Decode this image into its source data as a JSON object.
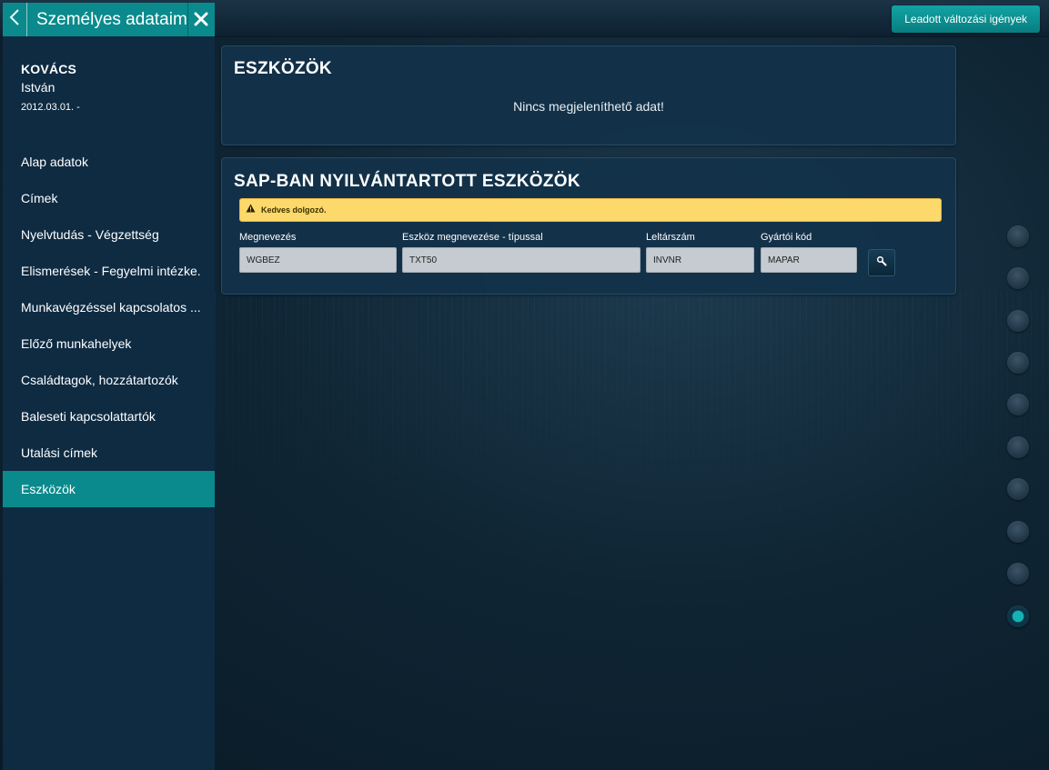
{
  "header": {
    "title": "Személyes adataim",
    "back_icon": "chevron-left-icon",
    "close_icon": "close-icon",
    "requests_button": "Leadott változási igények"
  },
  "user": {
    "surname": "KOVÁCS",
    "firstname": "István",
    "date": "2012.03.01. -"
  },
  "sidebar": {
    "items": [
      {
        "label": "Alap adatok",
        "active": false
      },
      {
        "label": "Címek",
        "active": false
      },
      {
        "label": "Nyelvtudás - Végzettség",
        "active": false
      },
      {
        "label": "Elismerések - Fegyelmi intézke.",
        "active": false
      },
      {
        "label": "Munkavégzéssel kapcsolatos ...",
        "active": false
      },
      {
        "label": "Előző munkahelyek",
        "active": false
      },
      {
        "label": "Családtagok, hozzátartozók",
        "active": false
      },
      {
        "label": "Baleseti kapcsolattartók",
        "active": false
      },
      {
        "label": "Utalási címek",
        "active": false
      },
      {
        "label": "Eszközök",
        "active": true
      }
    ]
  },
  "panel_assets": {
    "title": "ESZKÖZÖK",
    "empty_message": "Nincs megjeleníthető adat!"
  },
  "panel_sap": {
    "title": "SAP-BAN NYILVÁNTARTOTT ESZKÖZÖK",
    "alert": "Kedves dolgozó.",
    "alert_icon": "warning-icon",
    "fields": {
      "name_label": "Megnevezés",
      "name_value": "WGBEZ",
      "type_label": "Eszköz megnevezése - típussal",
      "type_value": "TXT50",
      "inventory_label": "Leltárszám",
      "inventory_value": "INVNR",
      "manufacturer_label": "Gyártói kód",
      "manufacturer_value": "MAPAR"
    },
    "search_icon": "search-icon"
  },
  "step_dots": {
    "count": 10,
    "active_index": 9
  },
  "colors": {
    "accent": "#0a8a8c",
    "sidebar_bg": "#0e2b42",
    "panel_bg": "#12324a",
    "alert_bg": "#fcd96a",
    "input_bg": "#c5cbd1"
  }
}
